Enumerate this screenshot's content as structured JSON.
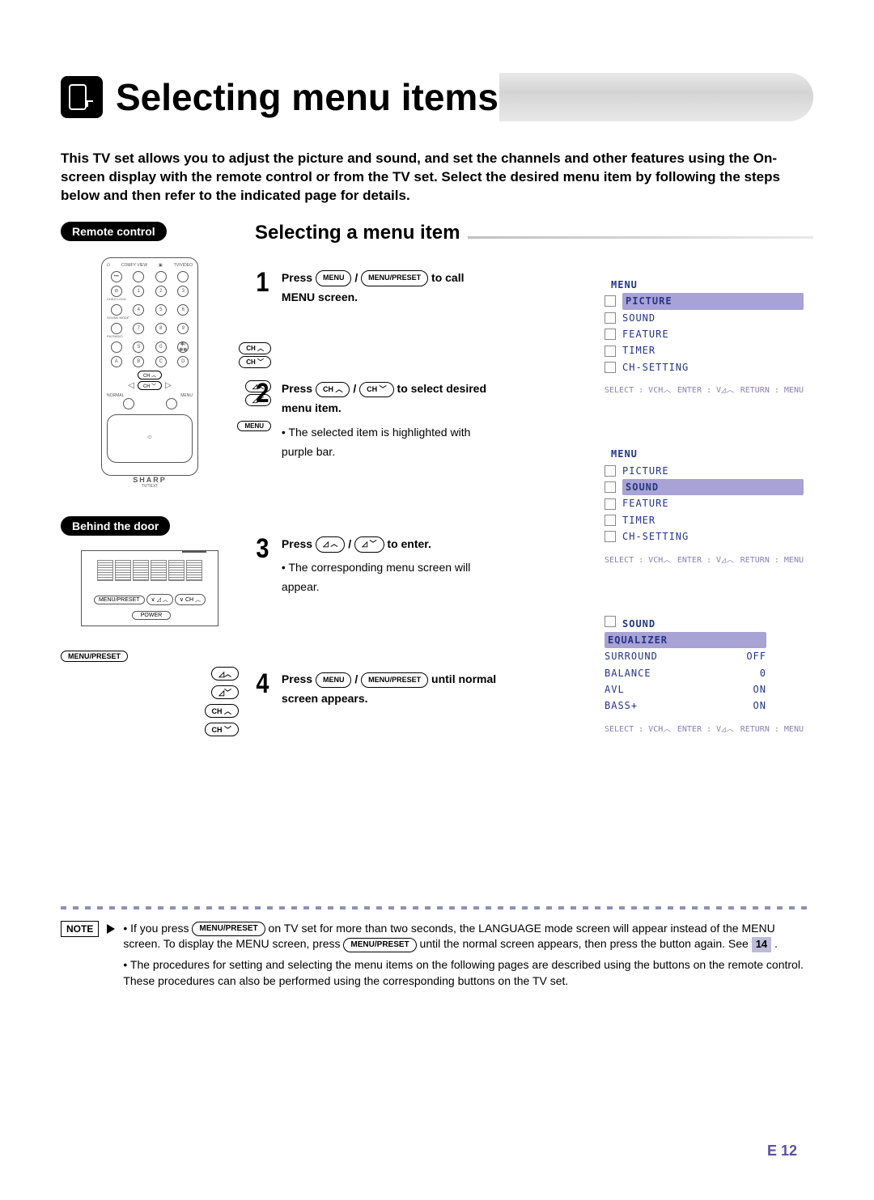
{
  "page_title": "Selecting menu items",
  "intro": "This TV set allows you to adjust the picture and sound, and set the channels and other features using the On-screen display with the remote control or from the TV set. Select the desired menu item by following the steps below and then refer to the indicated page for details.",
  "remote_control_label": "Remote control",
  "behind_door_label": "Behind the door",
  "sub_heading": "Selecting a menu item",
  "buttons": {
    "menu": "MENU",
    "menu_preset": "MENU/PRESET",
    "ch_up": "CH ︿",
    "ch_down": "CH ﹀",
    "vol_up": "◿︿",
    "vol_down": "◿﹀"
  },
  "remote_other": {
    "sharp": "SHARP",
    "tvtext": "TV/TEXT",
    "normal": "NORMAL",
    "menulbl": "MENU",
    "comfy": "COMFY VIEW",
    "tvvideo": "TV/VIDEO",
    "childlock": "CHILD LOCK",
    "soundmode": "SOUND MODE",
    "fmradio": "FM RADIO",
    "k1": "1",
    "k2": "2",
    "k3": "3",
    "k4": "4",
    "k5": "5",
    "k6": "6",
    "k7": "7",
    "k8": "8",
    "k9": "9",
    "k0": "0",
    "ks": "S",
    "kff": "✽/✽✽",
    "ka": "A",
    "kb": "B",
    "kc": "C",
    "kd": "D",
    "ch_tab": "CH ︿",
    "ch_tab2": "CH ﹀"
  },
  "behind_buttons": {
    "menu_preset": "MENU/PRESET",
    "voldn": "∨ ◿ ︿",
    "chup": "∨ CH ︿",
    "power": "POWER"
  },
  "steps": [
    {
      "n": "1",
      "pre": "Press ",
      "mid": " / ",
      "b1": "MENU",
      "b2": "MENU/PRESET",
      "post": " to call MENU screen."
    },
    {
      "n": "2",
      "pre": "Press ",
      "mid": " / ",
      "b1": "CH ︿",
      "b2": "CH ﹀",
      "post": " to select desired menu item.",
      "sub": "The selected item is highlighted with purple bar."
    },
    {
      "n": "3",
      "pre": "Press ",
      "mid": " / ",
      "b1": "◿ ︿",
      "b2": "◿ ﹀",
      "post": " to enter.",
      "sub": "The corresponding menu screen will appear."
    },
    {
      "n": "4",
      "pre": "Press ",
      "mid": " / ",
      "b1": "MENU",
      "b2": "MENU/PRESET",
      "post": " until normal screen appears."
    }
  ],
  "osd1": {
    "title": "MENU",
    "items": [
      "PICTURE",
      "SOUND",
      "FEATURE",
      "TIMER",
      "CH-SETTING"
    ],
    "sel": 0,
    "footer": {
      "a": "SELECT : VCH︿",
      "b": "ENTER : V◿︿",
      "c": "RETURN : MENU"
    }
  },
  "osd2": {
    "title": "MENU",
    "items": [
      "PICTURE",
      "SOUND",
      "FEATURE",
      "TIMER",
      "CH-SETTING"
    ],
    "sel": 1,
    "footer": {
      "a": "SELECT : VCH︿",
      "b": "ENTER : V◿︿",
      "c": "RETURN : MENU"
    }
  },
  "osd3": {
    "title": "SOUND",
    "rows": [
      [
        "EQUALIZER",
        ""
      ],
      [
        "SURROUND",
        "OFF"
      ],
      [
        "BALANCE",
        "0"
      ],
      [
        "AVL",
        "ON"
      ],
      [
        "BASS+",
        "ON"
      ]
    ],
    "sel": 0,
    "footer": {
      "a": "SELECT : VCH︿",
      "b": "ENTER : V◿︿",
      "c": "RETURN : MENU"
    }
  },
  "note_label": "NOTE",
  "notes": [
    "If you press |MENU/PRESET| on TV set for more than two seconds, the LANGUAGE mode screen will appear instead of the MENU screen. To display the MENU screen, press |MENU/PRESET| until the normal screen appears, then press the button again. See |14| .",
    "The procedures for setting and selecting the menu items on the following pages are described using the buttons on the remote control. These procedures can also be performed using the corresponding buttons on the TV set."
  ],
  "page_number": "E 12"
}
